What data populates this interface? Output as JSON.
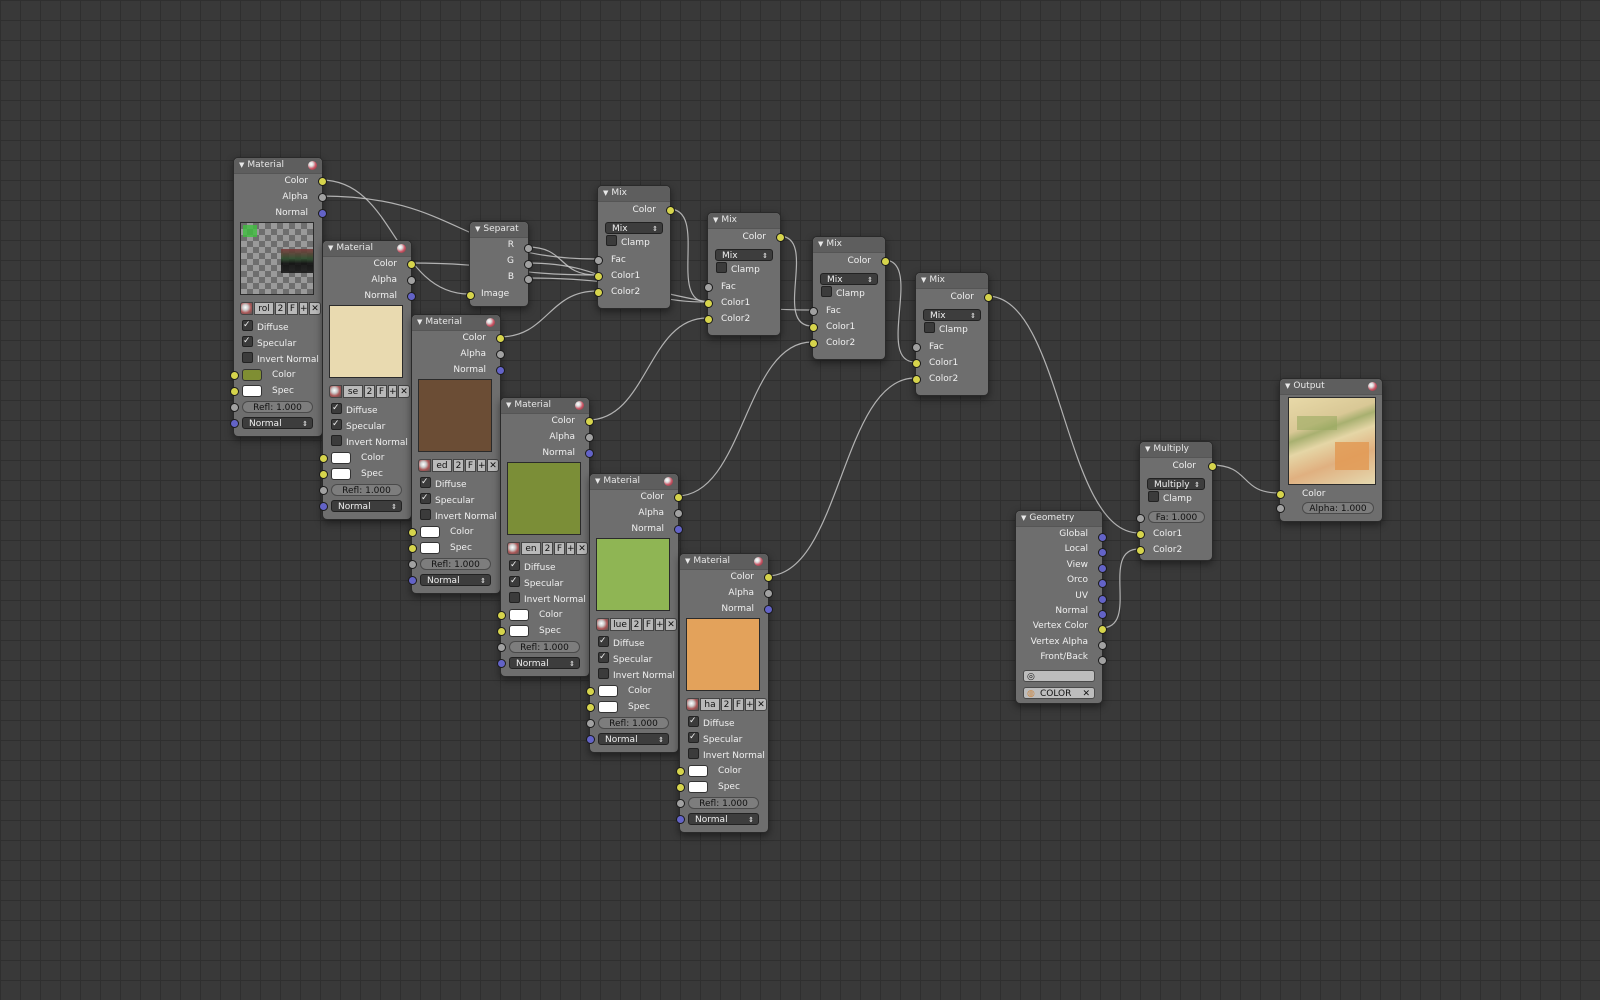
{
  "colors": {
    "background": "#393939",
    "socket_color": "#d6d44c",
    "socket_float": "#a1a1a1",
    "socket_vector": "#6363c7",
    "wire": "#c8c8c8"
  },
  "materials": [
    {
      "title": "Material",
      "out_color": "Color",
      "out_alpha": "Alpha",
      "out_normal": "Normal",
      "preview_color": "checker",
      "mat_name": "rol",
      "users": "2",
      "fake": "F",
      "plus": "+",
      "x": "✕",
      "diffuse": "Diffuse",
      "specular": "Specular",
      "invert_normal": "Invert Normal",
      "diffuse_on": true,
      "specular_on": true,
      "invert_on": false,
      "in_color": "Color",
      "in_spec": "Spec",
      "color_swatch": "#7f8e33",
      "spec_swatch": "#ffffff",
      "refl": "Refl: 1.000",
      "normal": "Normal"
    },
    {
      "title": "Material",
      "out_color": "Color",
      "out_alpha": "Alpha",
      "out_normal": "Normal",
      "preview_color": "#e9dab0",
      "mat_name": "se",
      "users": "2",
      "fake": "F",
      "plus": "+",
      "x": "✕",
      "diffuse": "Diffuse",
      "specular": "Specular",
      "invert_normal": "Invert Normal",
      "diffuse_on": true,
      "specular_on": true,
      "invert_on": false,
      "in_color": "Color",
      "in_spec": "Spec",
      "color_swatch": "#ffffff",
      "spec_swatch": "#ffffff",
      "refl": "Refl: 1.000",
      "normal": "Normal"
    },
    {
      "title": "Material",
      "out_color": "Color",
      "out_alpha": "Alpha",
      "out_normal": "Normal",
      "preview_color": "#6b4d35",
      "mat_name": "ed",
      "users": "2",
      "fake": "F",
      "plus": "+",
      "x": "✕",
      "diffuse": "Diffuse",
      "specular": "Specular",
      "invert_normal": "Invert Normal",
      "diffuse_on": true,
      "specular_on": true,
      "invert_on": false,
      "in_color": "Color",
      "in_spec": "Spec",
      "color_swatch": "#ffffff",
      "spec_swatch": "#ffffff",
      "refl": "Refl: 1.000",
      "normal": "Normal"
    },
    {
      "title": "Material",
      "out_color": "Color",
      "out_alpha": "Alpha",
      "out_normal": "Normal",
      "preview_color": "#7b8e37",
      "mat_name": "en",
      "users": "2",
      "fake": "F",
      "plus": "+",
      "x": "✕",
      "diffuse": "Diffuse",
      "specular": "Specular",
      "invert_normal": "Invert Normal",
      "diffuse_on": true,
      "specular_on": true,
      "invert_on": false,
      "in_color": "Color",
      "in_spec": "Spec",
      "color_swatch": "#ffffff",
      "spec_swatch": "#ffffff",
      "refl": "Refl: 1.000",
      "normal": "Normal"
    },
    {
      "title": "Material",
      "out_color": "Color",
      "out_alpha": "Alpha",
      "out_normal": "Normal",
      "preview_color": "#8fb554",
      "mat_name": "lue",
      "users": "2",
      "fake": "F",
      "plus": "+",
      "x": "✕",
      "diffuse": "Diffuse",
      "specular": "Specular",
      "invert_normal": "Invert Normal",
      "diffuse_on": true,
      "specular_on": true,
      "invert_on": false,
      "in_color": "Color",
      "in_spec": "Spec",
      "color_swatch": "#ffffff",
      "spec_swatch": "#ffffff",
      "refl": "Refl: 1.000",
      "normal": "Normal"
    },
    {
      "title": "Material",
      "out_color": "Color",
      "out_alpha": "Alpha",
      "out_normal": "Normal",
      "preview_color": "#e3a25b",
      "mat_name": "ha",
      "users": "2",
      "fake": "F",
      "plus": "+",
      "x": "✕",
      "diffuse": "Diffuse",
      "specular": "Specular",
      "invert_normal": "Invert Normal",
      "diffuse_on": true,
      "specular_on": true,
      "invert_on": false,
      "in_color": "Color",
      "in_spec": "Spec",
      "color_swatch": "#ffffff",
      "spec_swatch": "#ffffff",
      "refl": "Refl: 1.000",
      "normal": "Normal"
    }
  ],
  "separate": {
    "title": "Separat",
    "r": "R",
    "g": "G",
    "b": "B",
    "image": "Image"
  },
  "mixes": [
    {
      "title": "Mix",
      "out": "Color",
      "mode": "Mix",
      "clamp": "Clamp",
      "fac": "Fac",
      "c1": "Color1",
      "c2": "Color2"
    },
    {
      "title": "Mix",
      "out": "Color",
      "mode": "Mix",
      "clamp": "Clamp",
      "fac": "Fac",
      "c1": "Color1",
      "c2": "Color2"
    },
    {
      "title": "Mix",
      "out": "Color",
      "mode": "Mix",
      "clamp": "Clamp",
      "fac": "Fac",
      "c1": "Color1",
      "c2": "Color2"
    },
    {
      "title": "Mix",
      "out": "Color",
      "mode": "Mix",
      "clamp": "Clamp",
      "fac": "Fac",
      "c1": "Color1",
      "c2": "Color2"
    }
  ],
  "multiply": {
    "title": "Multiply",
    "out": "Color",
    "mode": "Multiply",
    "clamp": "Clamp",
    "fac": "Fa: 1.000",
    "c1": "Color1",
    "c2": "Color2"
  },
  "output": {
    "title": "Output",
    "in_color": "Color",
    "alpha": "Alpha: 1.000"
  },
  "geometry": {
    "title": "Geometry",
    "outputs": [
      "Global",
      "Local",
      "View",
      "Orco",
      "UV",
      "Normal",
      "Vertex Color",
      "Vertex Alpha",
      "Front/Back"
    ],
    "layer_field": "",
    "color_layer": "COLOR"
  }
}
